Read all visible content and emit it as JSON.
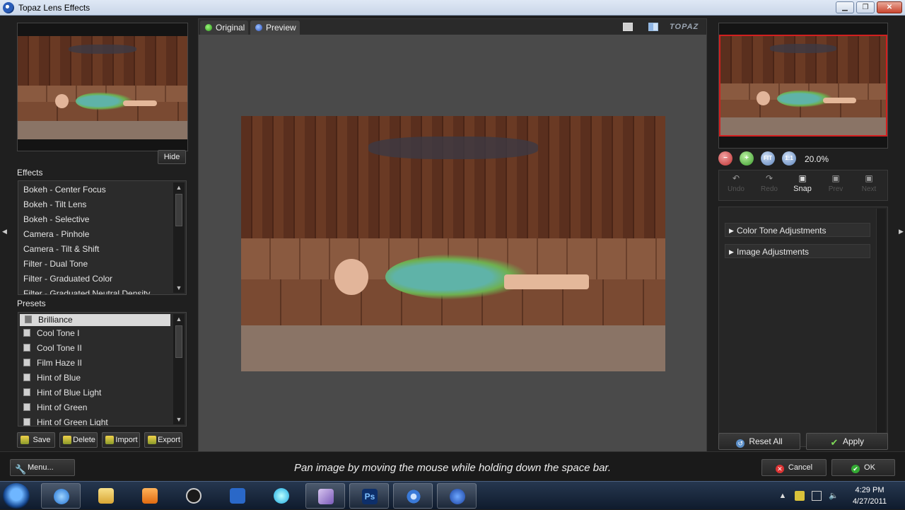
{
  "window": {
    "title": "Topaz Lens Effects",
    "controls": {
      "minimize": "▁",
      "maximize": "❐",
      "close": "✕"
    }
  },
  "left_panel": {
    "hide_label": "Hide",
    "effects_label": "Effects",
    "effects": [
      "Bokeh - Center Focus",
      "Bokeh - Tilt Lens",
      "Bokeh - Selective",
      "Camera - Pinhole",
      "Camera - Tilt & Shift",
      "Filter - Dual Tone",
      "Filter - Graduated Color",
      "Filter - Graduated Neutral Density"
    ],
    "presets_label": "Presets",
    "presets": [
      "Brilliance",
      "Cool Tone I",
      "Cool Tone II",
      "Film Haze II",
      "Hint of Blue",
      "Hint of Blue Light",
      "Hint of Green",
      "Hint of Green Light"
    ],
    "selected_preset": "Brilliance",
    "buttons": {
      "save": "Save",
      "delete": "Delete",
      "import": "Import",
      "export": "Export"
    }
  },
  "center": {
    "tabs": {
      "original": "Original",
      "preview": "Preview"
    },
    "logo": "TOPAZ"
  },
  "right_panel": {
    "zoom": {
      "out": "−",
      "in": "+",
      "fit": "FIT",
      "one_to_one": "1:1",
      "level": "20.0%"
    },
    "history": [
      {
        "label": "Undo",
        "icon": "undo-icon",
        "enabled": false
      },
      {
        "label": "Redo",
        "icon": "redo-icon",
        "enabled": false
      },
      {
        "label": "Snap",
        "icon": "camera-icon",
        "enabled": true
      },
      {
        "label": "Prev",
        "icon": "prev-icon",
        "enabled": false
      },
      {
        "label": "Next",
        "icon": "next-icon",
        "enabled": false
      }
    ],
    "adjustments": [
      "Color Tone Adjustments",
      "Image Adjustments"
    ],
    "reset_label": "Reset All",
    "apply_label": "Apply"
  },
  "status": {
    "menu_label": "Menu...",
    "hint": "Pan image by moving the mouse while holding down the space bar.",
    "cancel_label": "Cancel",
    "ok_label": "OK"
  },
  "taskbar": {
    "apps": [
      "internet-explorer",
      "file-explorer",
      "media-player",
      "hp-app",
      "task-app",
      "globe-app",
      "photo-app",
      "photoshop",
      "flower-app",
      "topaz-app"
    ],
    "photoshop_label": "Ps",
    "clock_time": "4:29 PM",
    "clock_date": "4/27/2011"
  },
  "colors": {
    "accent_red": "#d21f1f",
    "panel_bg": "#1f1f1f",
    "canvas_bg": "#4a4a4a"
  }
}
